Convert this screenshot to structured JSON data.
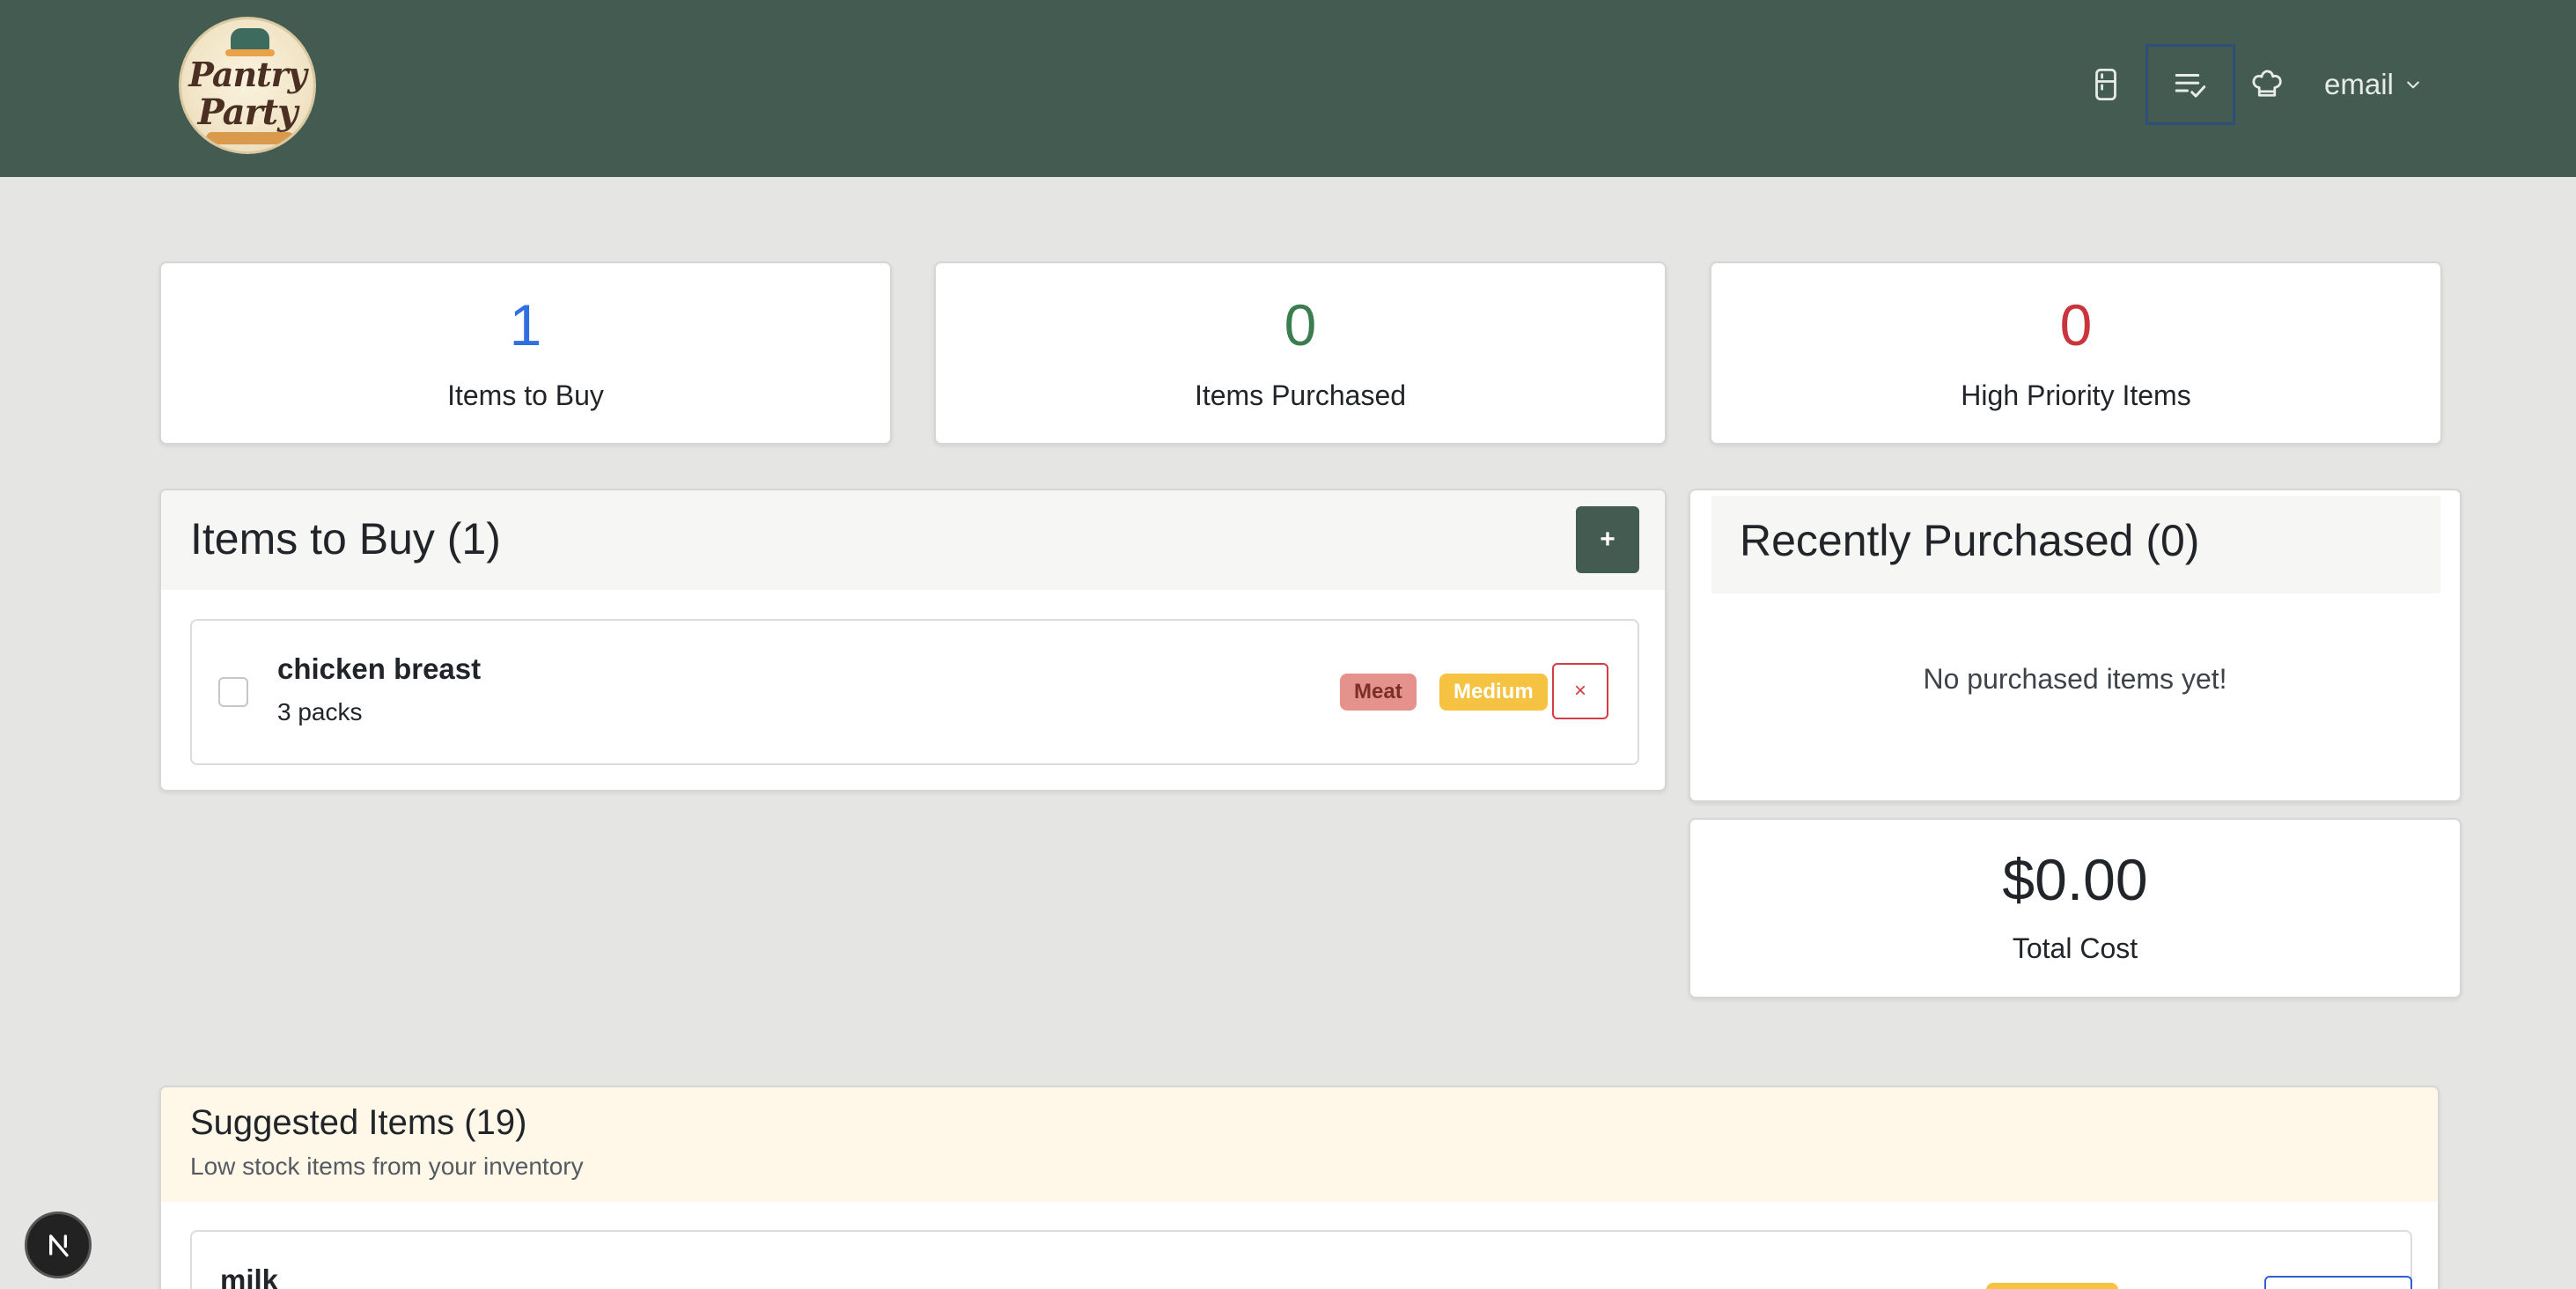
{
  "header": {
    "logo": {
      "line1": "Pantry",
      "line2": "Party"
    },
    "nav_icons": [
      "fridge-icon",
      "checklist-icon",
      "chef-hat-icon"
    ],
    "user_label": "email"
  },
  "stats": [
    {
      "value": "1",
      "label": "Items to Buy",
      "color": "#2f6fe0"
    },
    {
      "value": "0",
      "label": "Items Purchased",
      "color": "#3a7d4f"
    },
    {
      "value": "0",
      "label": "High Priority Items",
      "color": "#c9343d"
    }
  ],
  "to_buy": {
    "title": "Items to Buy (1)",
    "add_label": "+",
    "items": [
      {
        "name": "chicken breast",
        "quantity": "3 packs",
        "category": "Meat",
        "priority": "Medium",
        "remove_label": "×",
        "checked": false
      }
    ]
  },
  "recent": {
    "title": "Recently Purchased (0)",
    "empty_message": "No purchased items yet!"
  },
  "total": {
    "value": "$0.00",
    "label": "Total Cost"
  },
  "suggested": {
    "title": "Suggested Items (19)",
    "subtitle": "Low stock items from your inventory",
    "items": [
      {
        "name": "milk"
      }
    ]
  },
  "colors": {
    "brand": "#445b51",
    "background": "#e5e5e3",
    "meat_badge": "#e6928c",
    "priority_badge": "#f5c242",
    "danger": "#d23c44"
  }
}
